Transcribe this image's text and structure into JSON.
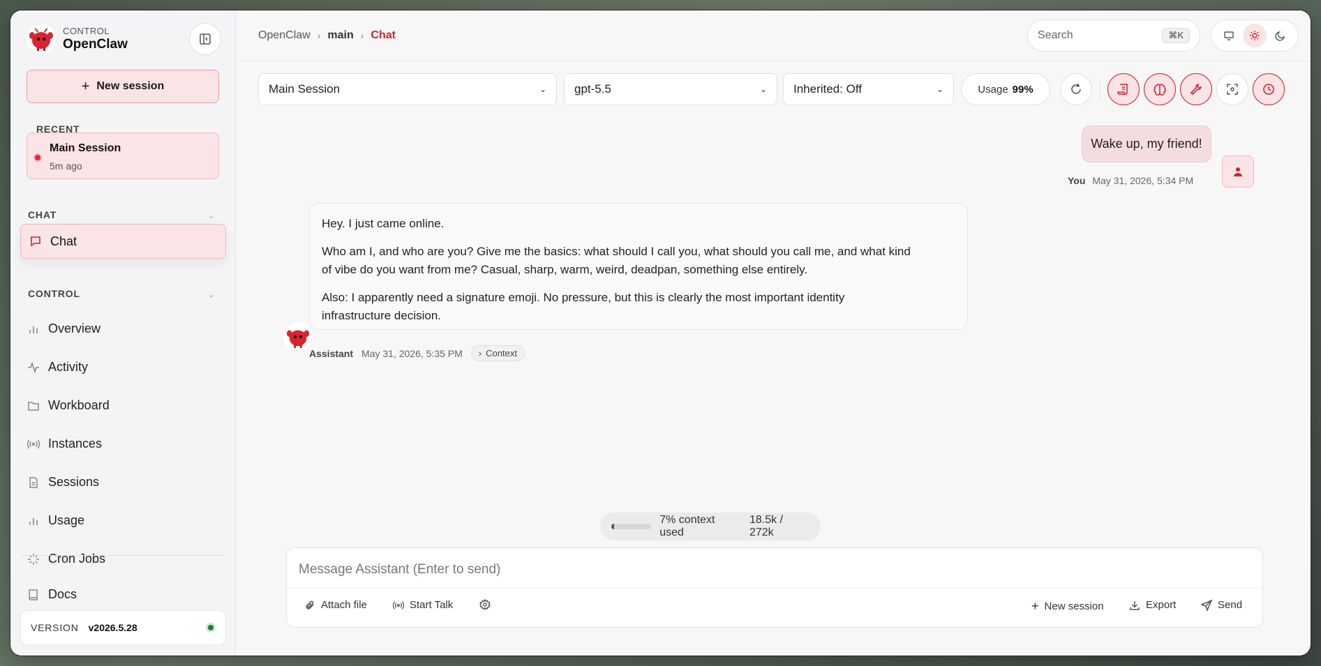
{
  "brand": {
    "sub": "CONTROL",
    "name": "OpenClaw"
  },
  "sidebar": {
    "new_session": "New session",
    "recent_label": "RECENT",
    "recent": {
      "title": "Main Session",
      "time": "5m ago"
    },
    "chat_section": "CHAT",
    "chat_item": "Chat",
    "control_section": "CONTROL",
    "items": [
      {
        "label": "Overview"
      },
      {
        "label": "Activity"
      },
      {
        "label": "Workboard"
      },
      {
        "label": "Instances"
      },
      {
        "label": "Sessions"
      },
      {
        "label": "Usage"
      },
      {
        "label": "Cron Jobs"
      }
    ],
    "docs": "Docs",
    "version_label": "VERSION",
    "version": "v2026.5.28"
  },
  "breadcrumb": {
    "root": "OpenClaw",
    "mid": "main",
    "current": "Chat"
  },
  "search": {
    "placeholder": "Search",
    "shortcut": "⌘K"
  },
  "toolbar": {
    "session": "Main Session",
    "model": "gpt-5.5",
    "inherited": "Inherited: Off",
    "usage_label": "Usage",
    "usage_value": "99%"
  },
  "messages": {
    "user": {
      "text": "Wake up, my friend!",
      "who": "You",
      "time": "May 31, 2026, 5:34 PM"
    },
    "assistant": {
      "p1": "Hey. I just came online.",
      "p2": "Who am I, and who are you? Give me the basics: what should I call you, what should you call me, and what kind of vibe do you want from me? Casual, sharp, warm, weird, deadpan, something else entirely.",
      "p3": "Also: I apparently need a signature emoji. No pressure, but this is clearly the most important identity infrastructure decision.",
      "who": "Assistant",
      "time": "May 31, 2026, 5:35 PM",
      "context": "Context"
    }
  },
  "context_usage": {
    "percent": 7,
    "label": "7% context used",
    "tokens": "18.5k / 272k"
  },
  "composer": {
    "placeholder": "Message Assistant (Enter to send)",
    "attach": "Attach file",
    "talk": "Start Talk",
    "new_session": "New session",
    "export": "Export",
    "send": "Send"
  },
  "colors": {
    "accent": "#d21f32",
    "accent_bg": "#fbe4e6",
    "status_ok": "#188038"
  }
}
